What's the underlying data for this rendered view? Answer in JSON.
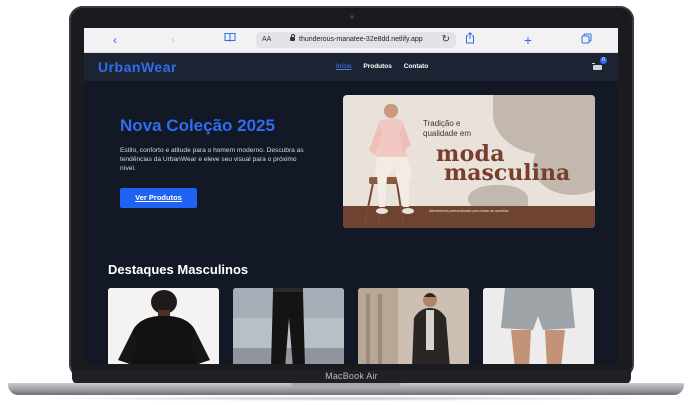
{
  "device": {
    "label": "MacBook Air"
  },
  "browser": {
    "text_size_label": "AA",
    "url": "thunderous-manatee-32e8dd.netlify.app",
    "back_glyph": "‹",
    "forward_glyph": "›",
    "bookmarks_glyph": "📖",
    "reload_glyph": "↻",
    "share_glyph": "⇪",
    "new_tab_glyph": "+",
    "tabs_glyph": "⧉"
  },
  "site": {
    "logo": "UrbanWear",
    "nav": [
      {
        "label": "Início",
        "active": true
      },
      {
        "label": "Produtos",
        "active": false
      },
      {
        "label": "Contato",
        "active": false
      }
    ],
    "cart_count": "0"
  },
  "hero": {
    "title": "Nova Coleção 2025",
    "text": "Estilo, conforto e atitude para o homem moderno. Descubra as tendências da UrbanWear e eleve seu visual para o próximo nível.",
    "button": "Ver Produtos"
  },
  "banner": {
    "tagline_line1": "Tradição e",
    "tagline_line2": "qualidade em",
    "headline_line1": "moda",
    "headline_line2": "masculina",
    "footer_text": "Atendimento personalizado para todas as ocasiões."
  },
  "featured": {
    "title": "Destaques Masculinos",
    "products": [
      {
        "image": "black-tshirt-photo"
      },
      {
        "image": "black-jeans-photo"
      },
      {
        "image": "leather-jacket-photo"
      },
      {
        "image": "grey-shorts-photo"
      }
    ]
  },
  "colors": {
    "accent": "#2f6df0",
    "page_bg": "#121826",
    "nav_bg": "#1c2434",
    "banner_brown": "#7a3e2c"
  }
}
